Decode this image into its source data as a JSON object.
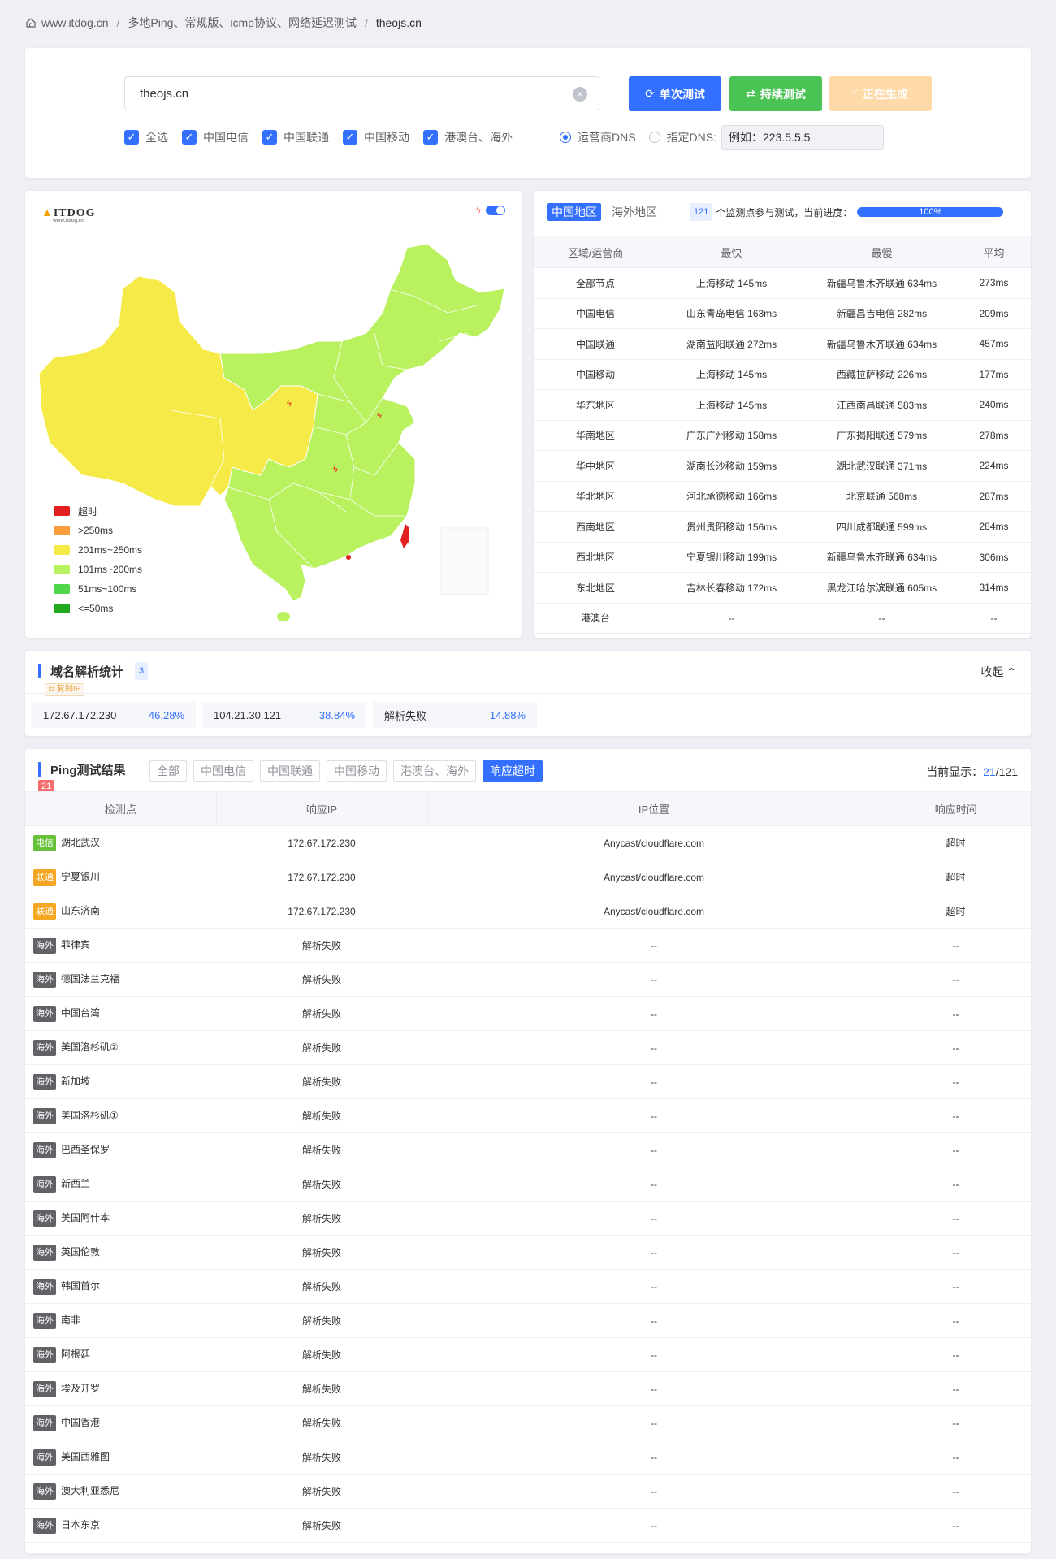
{
  "breadcrumb": {
    "home": "www.itdog.cn",
    "section": "多地Ping、常规版、icmp协议、网络延迟测试",
    "current": "theojs.cn"
  },
  "search": {
    "value": "theojs.cn",
    "clear_icon": "×",
    "btn_single": "单次测试",
    "btn_continuous": "持续测试",
    "btn_generating": "正在生成",
    "colors": {
      "blue": "#3370ff",
      "green": "#4cc455",
      "orange": "#ffc56e"
    },
    "checkboxes": [
      "全选",
      "中国电信",
      "中国联通",
      "中国移动",
      "港澳台、海外"
    ],
    "radio_isp_dns": "运营商DNS",
    "radio_custom_dns": "指定DNS:",
    "dns_placeholder": "例如：223.5.5.5"
  },
  "map": {
    "logo": "ITDOG",
    "logo_sub": "www.itdog.cn",
    "legend": [
      {
        "label": "超时",
        "color": "#e21f1f"
      },
      {
        "label": ">250ms",
        "color": "#fa9d3b"
      },
      {
        "label": "201ms~250ms",
        "color": "#f6ea48"
      },
      {
        "label": "101ms~200ms",
        "color": "#b9f15f"
      },
      {
        "label": "51ms~100ms",
        "color": "#4fd64b"
      },
      {
        "label": "<=50ms",
        "color": "#21a81c"
      }
    ]
  },
  "stats": {
    "tab_china": "中国地区",
    "tab_overseas": "海外地区",
    "node_count": "121",
    "progress_text": "个监测点参与测试，当前进度：",
    "progress": "100%",
    "headers": [
      "区域/运营商",
      "最快",
      "最慢",
      "平均"
    ],
    "rows": [
      [
        "全部节点",
        "上海移动 145ms",
        "新疆乌鲁木齐联通 634ms",
        "273ms"
      ],
      [
        "中国电信",
        "山东青岛电信 163ms",
        "新疆昌吉电信 282ms",
        "209ms"
      ],
      [
        "中国联通",
        "湖南益阳联通 272ms",
        "新疆乌鲁木齐联通 634ms",
        "457ms"
      ],
      [
        "中国移动",
        "上海移动 145ms",
        "西藏拉萨移动 226ms",
        "177ms"
      ],
      [
        "华东地区",
        "上海移动 145ms",
        "江西南昌联通 583ms",
        "240ms"
      ],
      [
        "华南地区",
        "广东广州移动 158ms",
        "广东揭阳联通 579ms",
        "278ms"
      ],
      [
        "华中地区",
        "湖南长沙移动 159ms",
        "湖北武汉联通 371ms",
        "224ms"
      ],
      [
        "华北地区",
        "河北承德移动 166ms",
        "北京联通 568ms",
        "287ms"
      ],
      [
        "西南地区",
        "贵州贵阳移动 156ms",
        "四川成都联通 599ms",
        "284ms"
      ],
      [
        "西北地区",
        "宁夏银川移动 199ms",
        "新疆乌鲁木齐联通 634ms",
        "306ms"
      ],
      [
        "东北地区",
        "吉林长春移动 172ms",
        "黑龙江哈尔滨联通 605ms",
        "314ms"
      ],
      [
        "港澳台",
        "--",
        "--",
        "--"
      ]
    ]
  },
  "dns": {
    "title": "域名解析统计",
    "count": "3",
    "copy_ip": "复制IP",
    "collapse": "收起 ⌃",
    "items": [
      {
        "ip": "172.67.172.230",
        "pct": "46.28%"
      },
      {
        "ip": "104.21.30.121",
        "pct": "38.84%"
      },
      {
        "ip": "解析失败",
        "pct": "14.88%"
      }
    ]
  },
  "ping": {
    "title": "Ping测试结果",
    "count": "21",
    "filters": [
      "全部",
      "中国电信",
      "中国联通",
      "中国移动",
      "港澳台、海外",
      "响应超时"
    ],
    "showing_label": "当前显示：",
    "showing_current": "21",
    "showing_total": "/121",
    "headers": [
      "检测点",
      "响应IP",
      "IP位置",
      "响应时间"
    ],
    "isp_colors": {
      "电信": "#67c23a",
      "联通": "#f5a623",
      "海外": "#606266"
    },
    "rows": [
      {
        "isp": "电信",
        "node": "湖北武汉",
        "ip": "172.67.172.230",
        "loc": "Anycast/cloudflare.com",
        "time": "超时"
      },
      {
        "isp": "联通",
        "node": "宁夏银川",
        "ip": "172.67.172.230",
        "loc": "Anycast/cloudflare.com",
        "time": "超时"
      },
      {
        "isp": "联通",
        "node": "山东济南",
        "ip": "172.67.172.230",
        "loc": "Anycast/cloudflare.com",
        "time": "超时"
      },
      {
        "isp": "海外",
        "node": "菲律宾",
        "ip": "解析失败",
        "loc": "--",
        "time": "--"
      },
      {
        "isp": "海外",
        "node": "德国法兰克福",
        "ip": "解析失败",
        "loc": "--",
        "time": "--"
      },
      {
        "isp": "海外",
        "node": "中国台湾",
        "ip": "解析失败",
        "loc": "--",
        "time": "--"
      },
      {
        "isp": "海外",
        "node": "美国洛杉矶②",
        "ip": "解析失败",
        "loc": "--",
        "time": "--"
      },
      {
        "isp": "海外",
        "node": "新加坡",
        "ip": "解析失败",
        "loc": "--",
        "time": "--"
      },
      {
        "isp": "海外",
        "node": "美国洛杉矶①",
        "ip": "解析失败",
        "loc": "--",
        "time": "--"
      },
      {
        "isp": "海外",
        "node": "巴西圣保罗",
        "ip": "解析失败",
        "loc": "--",
        "time": "--"
      },
      {
        "isp": "海外",
        "node": "新西兰",
        "ip": "解析失败",
        "loc": "--",
        "time": "--"
      },
      {
        "isp": "海外",
        "node": "美国阿什本",
        "ip": "解析失败",
        "loc": "--",
        "time": "--"
      },
      {
        "isp": "海外",
        "node": "英国伦敦",
        "ip": "解析失败",
        "loc": "--",
        "time": "--"
      },
      {
        "isp": "海外",
        "node": "韩国首尔",
        "ip": "解析失败",
        "loc": "--",
        "time": "--"
      },
      {
        "isp": "海外",
        "node": "南非",
        "ip": "解析失败",
        "loc": "--",
        "time": "--"
      },
      {
        "isp": "海外",
        "node": "阿根廷",
        "ip": "解析失败",
        "loc": "--",
        "time": "--"
      },
      {
        "isp": "海外",
        "node": "埃及开罗",
        "ip": "解析失败",
        "loc": "--",
        "time": "--"
      },
      {
        "isp": "海外",
        "node": "中国香港",
        "ip": "解析失败",
        "loc": "--",
        "time": "--"
      },
      {
        "isp": "海外",
        "node": "美国西雅图",
        "ip": "解析失败",
        "loc": "--",
        "time": "--"
      },
      {
        "isp": "海外",
        "node": "澳大利亚悉尼",
        "ip": "解析失败",
        "loc": "--",
        "time": "--"
      },
      {
        "isp": "海外",
        "node": "日本东京",
        "ip": "解析失败",
        "loc": "--",
        "time": "--"
      }
    ]
  }
}
